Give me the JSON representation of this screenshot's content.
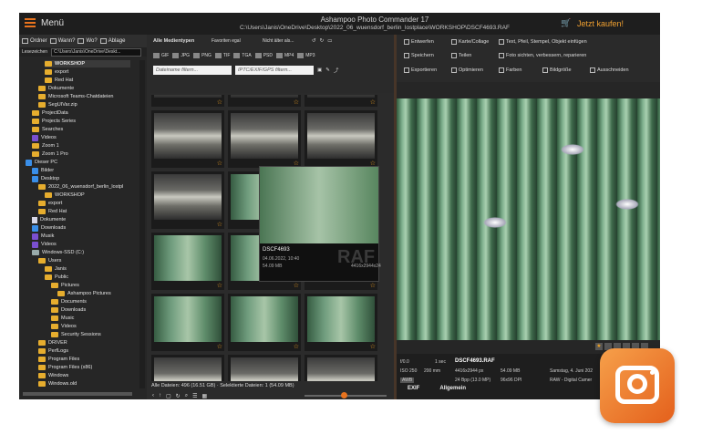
{
  "title_bar": {
    "menu_label": "Menü",
    "app_title": "Ashampoo Photo Commander 17",
    "path": "C:\\Users\\Janis\\OneDrive\\Desktop\\2022_06_wuensdorf_berlin_lostplace\\WORKSHOP\\DSCF4693.RAF",
    "buy_label": "Jetzt kaufen!"
  },
  "left_nav": {
    "buttons": [
      {
        "label": "Ordner"
      },
      {
        "label": "Wann?"
      },
      {
        "label": "Wo?"
      },
      {
        "label": "Ablage"
      }
    ],
    "bookmarks_label": "Lesezeichen",
    "path_value": "C:\\Users\\Janis\\OneDrive\\Deskt...",
    "tree": [
      {
        "label": "WORKSHOP",
        "icon": "folder",
        "indent": 4,
        "selected": true
      },
      {
        "label": "export",
        "icon": "folder",
        "indent": 4
      },
      {
        "label": "Red Hat",
        "icon": "folder",
        "indent": 4
      },
      {
        "label": "Dokumente",
        "icon": "folder",
        "indent": 3
      },
      {
        "label": "Microsoft Teams-Chatdateien",
        "icon": "folder",
        "indent": 3
      },
      {
        "label": "SegUIVar.zip",
        "icon": "folder",
        "indent": 3
      },
      {
        "label": "ProjectData",
        "icon": "folder",
        "indent": 2
      },
      {
        "label": "Projects Series",
        "icon": "folder",
        "indent": 2
      },
      {
        "label": "Searches",
        "icon": "folder",
        "indent": 2
      },
      {
        "label": "Videos",
        "icon": "purple",
        "indent": 2
      },
      {
        "label": "Zoom 1",
        "icon": "folder",
        "indent": 2
      },
      {
        "label": "Zoom 1 Pro",
        "icon": "folder",
        "indent": 2
      },
      {
        "label": "Dieser PC",
        "icon": "blue",
        "indent": 1
      },
      {
        "label": "Bilder",
        "icon": "blue",
        "indent": 2
      },
      {
        "label": "Desktop",
        "icon": "blue",
        "indent": 2
      },
      {
        "label": "2022_06_wuensdorf_berlin_lostpl",
        "icon": "folder",
        "indent": 3
      },
      {
        "label": "WORKSHOP",
        "icon": "folder",
        "indent": 4
      },
      {
        "label": "export",
        "icon": "folder",
        "indent": 3
      },
      {
        "label": "Red Hat",
        "icon": "folder",
        "indent": 3
      },
      {
        "label": "Dokumente",
        "icon": "doc",
        "indent": 2
      },
      {
        "label": "Downloads",
        "icon": "blue",
        "indent": 2
      },
      {
        "label": "Musik",
        "icon": "purple",
        "indent": 2
      },
      {
        "label": "Videos",
        "icon": "purple",
        "indent": 2
      },
      {
        "label": "Windows-SSD (C:)",
        "icon": "drive",
        "indent": 2
      },
      {
        "label": "Users",
        "icon": "folder",
        "indent": 3
      },
      {
        "label": "Janis",
        "icon": "folder",
        "indent": 4
      },
      {
        "label": "Public",
        "icon": "folder",
        "indent": 4
      },
      {
        "label": "Pictures",
        "icon": "folder",
        "indent": 5
      },
      {
        "label": "Ashampoo Pictures",
        "icon": "folder",
        "indent": 6
      },
      {
        "label": "Documents",
        "icon": "folder",
        "indent": 5
      },
      {
        "label": "Downloads",
        "icon": "folder",
        "indent": 5
      },
      {
        "label": "Music",
        "icon": "folder",
        "indent": 5
      },
      {
        "label": "Videos",
        "icon": "folder",
        "indent": 5
      },
      {
        "label": "Security Sessions",
        "icon": "folder",
        "indent": 5
      },
      {
        "label": "DRIVER",
        "icon": "folder",
        "indent": 3
      },
      {
        "label": "PerfLogs",
        "icon": "folder",
        "indent": 3
      },
      {
        "label": "Program Files",
        "icon": "folder",
        "indent": 3
      },
      {
        "label": "Program Files (x86)",
        "icon": "folder",
        "indent": 3
      },
      {
        "label": "Windows",
        "icon": "folder",
        "indent": 3
      },
      {
        "label": "Windows.old",
        "icon": "folder",
        "indent": 3
      }
    ]
  },
  "filter": {
    "media_type": "Alle Medientypen",
    "favorites": "Favoriten egal",
    "age": "Nicht älter als...",
    "formats": [
      "GIF",
      "JPG",
      "PNG",
      "TIF",
      "TGA",
      "PSD",
      "MP4",
      "MP3"
    ],
    "filename_placeholder": "Dateiname filtern...",
    "meta_placeholder": "IPTC/EXIF/GPS filtern..."
  },
  "popup": {
    "name": "DSCF4693",
    "date": "04.06.2022, 10:40",
    "size": "54.09 MB",
    "dims": "4416x2944x24",
    "badge": "RAF"
  },
  "status": {
    "text": "Alle Dateien: 496 (16.51 GB) · Selektierte Dateien: 1 (54.09 MB)"
  },
  "right_toolbar": [
    {
      "label": "Entwerfen"
    },
    {
      "label": "Karte/Collage"
    },
    {
      "label": "Text, Pfeil, Stempel, Objekt einfügen"
    },
    {
      "label": "Speichern"
    },
    {
      "label": "Teilen"
    },
    {
      "label": "Foto sichten, verbessern, reparieren"
    },
    {
      "label": "Exportieren"
    },
    {
      "label": "Optimieren"
    },
    {
      "label": "Farben"
    },
    {
      "label": "Bildgröße"
    },
    {
      "label": "Ausschneiden"
    }
  ],
  "meta": {
    "aperture": "f/0.0",
    "shutter": "1 sec",
    "filename": "DSCF4693.RAF",
    "iso": "ISO 250",
    "focal": "200 mm",
    "dims": "4416x2944 px",
    "filesize": "54.09 MB",
    "date": "Samstag, 4. Juni 202",
    "bpp": "24 Bpp (13.0 MP)",
    "dpi": "96x96 DPI",
    "type": "RAW - Digital Camer",
    "awb": "AWB"
  },
  "tabs": {
    "exif": "EXIF",
    "general": "Allgemein"
  },
  "colors": {
    "accent": "#e8731e",
    "buy": "#f0a030",
    "star": "#f0a020"
  }
}
